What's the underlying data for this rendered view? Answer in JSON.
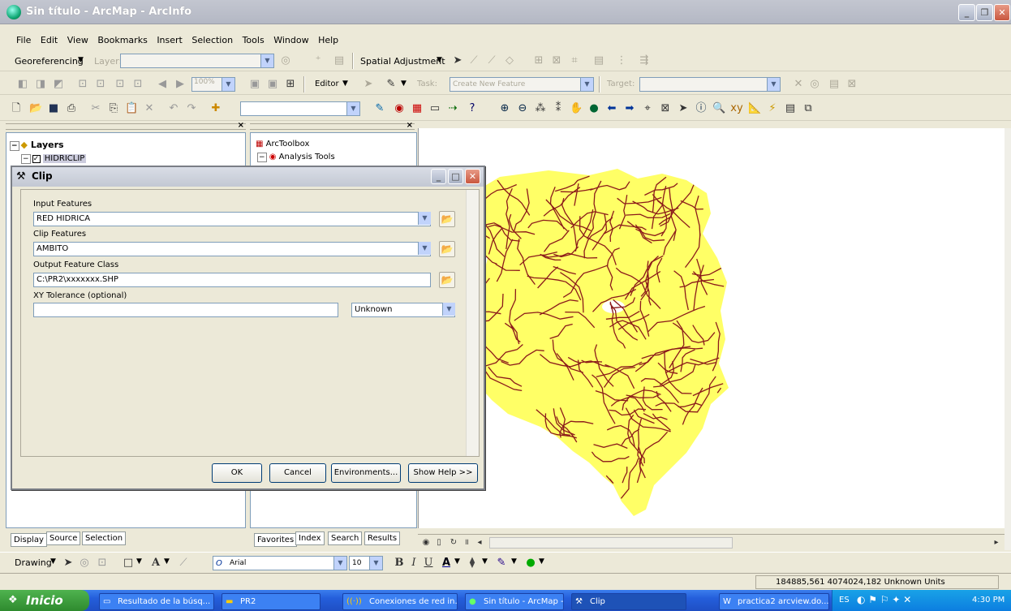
{
  "window": {
    "title": "Sin título - ArcMap - ArcInfo"
  },
  "menu": [
    "File",
    "Edit",
    "View",
    "Bookmarks",
    "Insert",
    "Selection",
    "Tools",
    "Window",
    "Help"
  ],
  "georef_toolbar": {
    "georeferencing_label": "Georeferencing",
    "layer_label": "Layer:",
    "spatial_adjustment_label": "Spatial Adjustment"
  },
  "editor_toolbar": {
    "zoom_value": "100%",
    "editor_label": "Editor",
    "task_label": "Task:",
    "task_value": "Create New Feature",
    "target_label": "Target:"
  },
  "toc": {
    "root_label": "Layers",
    "layer_name": "HIDRICLIP",
    "tabs": [
      "Display",
      "Source",
      "Selection"
    ]
  },
  "arctoolbox": {
    "root_label": "ArcToolbox",
    "item_label": "Analysis Tools",
    "tabs": [
      "Favorites",
      "Index",
      "Search",
      "Results"
    ]
  },
  "clip_dialog": {
    "title": "Clip",
    "input_features_label": "Input Features",
    "input_features_value": "RED HIDRICA",
    "clip_features_label": "Clip Features",
    "clip_features_value": "AMBITO",
    "output_label": "Output Feature Class",
    "output_value": "C:\\PR2\\xxxxxxx.SHP",
    "xy_tolerance_label": "XY Tolerance (optional)",
    "xy_tolerance_unit": "Unknown",
    "buttons": {
      "ok": "OK",
      "cancel": "Cancel",
      "environments": "Environments...",
      "show_help": "Show Help >>"
    }
  },
  "drawing_toolbar": {
    "drawing_label": "Drawing",
    "font_name": "Arial",
    "font_size": "10",
    "bold": "B",
    "italic": "I",
    "underline": "U"
  },
  "status": {
    "coordinates": "184885,561  4074024,182 Unknown Units"
  },
  "taskbar": {
    "start_label": "Inicio",
    "tasks": [
      "Resultado de la búsq...",
      "PR2",
      "Conexiones de red in...",
      "Sin título - ArcMap - ...",
      "Clip",
      "practica2 arcview.do..."
    ],
    "language": "ES",
    "time": "4:30 PM"
  },
  "colors": {
    "map_fill": "#ffff66",
    "river_color": "#8b1a1a",
    "taskbar_blue": "#245edb"
  }
}
